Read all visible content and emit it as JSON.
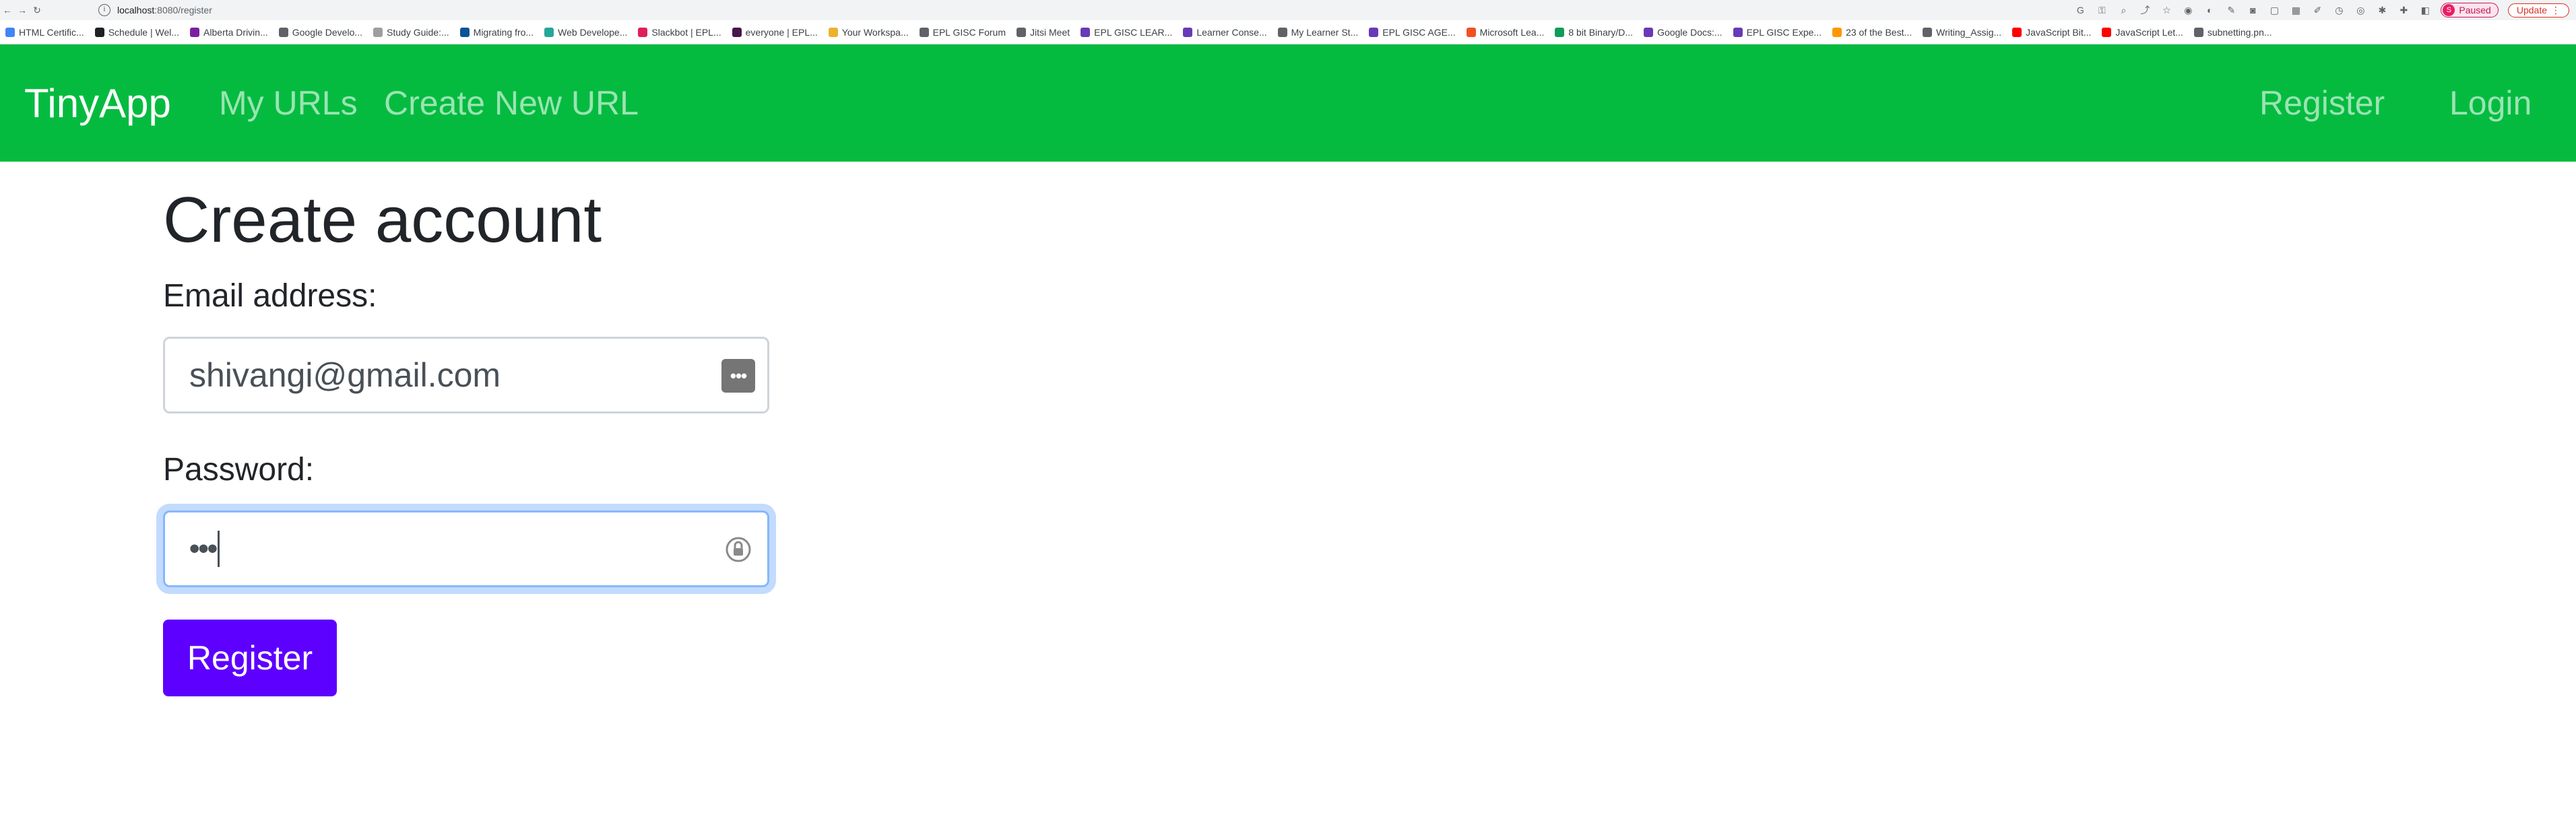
{
  "browser": {
    "url_host": "localhost",
    "url_path": ":8080/register",
    "profile_initial": "S",
    "profile_status": "Paused",
    "update_label": "Update"
  },
  "bookmarks": [
    {
      "label": "HTML Certific...",
      "color": "#4285f4"
    },
    {
      "label": "Schedule | Wel...",
      "color": "#202124"
    },
    {
      "label": "Alberta Drivin...",
      "color": "#7b1fa2"
    },
    {
      "label": "Google Develo...",
      "color": "#5f6368"
    },
    {
      "label": "Study Guide:...",
      "color": "#9e9e9e"
    },
    {
      "label": "Migrating fro...",
      "color": "#0b5394"
    },
    {
      "label": "Web Develope...",
      "color": "#26a69a"
    },
    {
      "label": "Slackbot | EPL...",
      "color": "#e01e5a"
    },
    {
      "label": "everyone | EPL...",
      "color": "#4a154b"
    },
    {
      "label": "Your Workspa...",
      "color": "#ecb22e"
    },
    {
      "label": "EPL GISC Forum",
      "color": "#5f6368"
    },
    {
      "label": "Jitsi Meet",
      "color": "#5f6368"
    },
    {
      "label": "EPL GISC LEAR...",
      "color": "#673ab7"
    },
    {
      "label": "Learner Conse...",
      "color": "#673ab7"
    },
    {
      "label": "My Learner St...",
      "color": "#5f6368"
    },
    {
      "label": "EPL GISC AGE...",
      "color": "#673ab7"
    },
    {
      "label": "Microsoft Lea...",
      "color": "#f25022"
    },
    {
      "label": "8 bit Binary/D...",
      "color": "#0f9d58"
    },
    {
      "label": "Google Docs:...",
      "color": "#673ab7"
    },
    {
      "label": "EPL GISC Expe...",
      "color": "#673ab7"
    },
    {
      "label": "23 of the Best...",
      "color": "#ff9800"
    },
    {
      "label": "Writing_Assig...",
      "color": "#5f6368"
    },
    {
      "label": "JavaScript Bit...",
      "color": "#ff0000"
    },
    {
      "label": "JavaScript Let...",
      "color": "#ff0000"
    },
    {
      "label": "subnetting.pn...",
      "color": "#5f6368"
    }
  ],
  "navbar": {
    "brand": "TinyApp",
    "my_urls": "My URLs",
    "create_new_url": "Create New URL",
    "register": "Register",
    "login": "Login",
    "bg_color": "#04bb40"
  },
  "form": {
    "title": "Create account",
    "email_label": "Email address:",
    "email_value": "shivangi@gmail.com",
    "password_label": "Password:",
    "password_mask": "•••",
    "submit_label": "Register",
    "submit_color": "#5d00ff"
  }
}
